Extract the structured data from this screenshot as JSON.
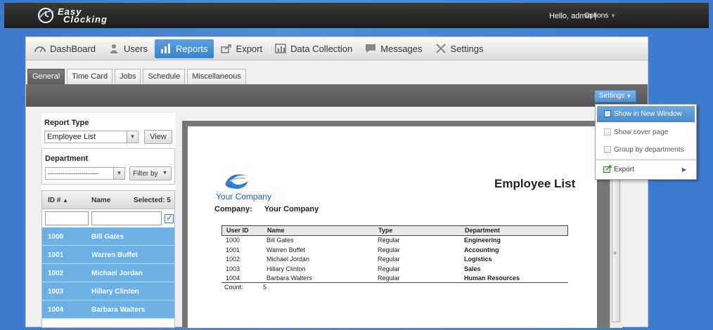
{
  "topbar": {
    "logo_line1": "Easy",
    "logo_line2": "Clocking",
    "greeting": "Hello, admin |",
    "options_label": "Options"
  },
  "nav": {
    "items": [
      {
        "label": "DashBoard",
        "icon": "dashboard-icon"
      },
      {
        "label": "Users",
        "icon": "user-icon"
      },
      {
        "label": "Reports",
        "icon": "bar-chart-icon"
      },
      {
        "label": "Export",
        "icon": "export-icon"
      },
      {
        "label": "Data Collection",
        "icon": "data-collection-icon"
      },
      {
        "label": "Messages",
        "icon": "message-icon"
      },
      {
        "label": "Settings",
        "icon": "tools-icon"
      }
    ],
    "active": "Reports"
  },
  "subtabs": [
    "General",
    "Time Card",
    "Jobs",
    "Schedule",
    "Miscellaneous"
  ],
  "settings_button": "Settings",
  "left": {
    "report_type_label": "Report Type",
    "report_type_value": "Employee List",
    "view_button": "View",
    "department_label": "Department",
    "department_value": "------------------------",
    "filter_by": "Filter by",
    "grid": {
      "col_id": "ID #",
      "col_name": "Name",
      "selected": "Selected: 5",
      "rows": [
        {
          "id": "1000",
          "name": "Bill Gates"
        },
        {
          "id": "1001",
          "name": "Warren Buffet"
        },
        {
          "id": "1002",
          "name": "Michael Jordan"
        },
        {
          "id": "1003",
          "name": "Hillary Clinton"
        },
        {
          "id": "1004",
          "name": "Barbara Walters"
        }
      ]
    }
  },
  "report": {
    "company_logo_text": "Your Company",
    "title": "Employee List",
    "company_label": "Company:",
    "company_value": "Your Company",
    "headers": [
      "User ID",
      "Name",
      "Type",
      "Department"
    ],
    "rows": [
      [
        "1000",
        "Bill  Gates",
        "Regular",
        "Engineering"
      ],
      [
        "1001",
        "Warren Buffet",
        "Regular",
        "Accounting"
      ],
      [
        "1002",
        "Michael Jordan",
        "Regular",
        "Logistics"
      ],
      [
        "1003",
        "Hillary Clinton",
        "Regular",
        "Sales"
      ],
      [
        "1004",
        "Barbara Walters",
        "Regular",
        "Human Resources"
      ]
    ],
    "count_label": "Count:",
    "count_value": "5"
  },
  "menu": {
    "items": [
      "Show in New Window",
      "Show cover page",
      "Group by departments"
    ],
    "export": "Export"
  }
}
